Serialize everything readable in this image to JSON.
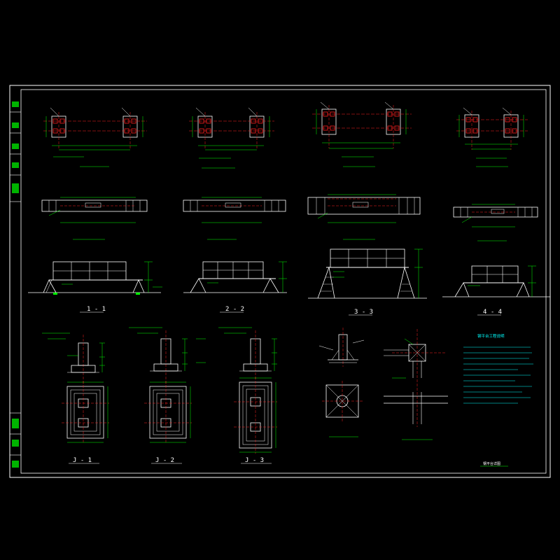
{
  "drawing": {
    "colors": {
      "background": "#000000",
      "frame": "#ffffff",
      "structure": "#ffffff",
      "dimension": "#00ff00",
      "axis": "#ff2020",
      "text": "#ffffff",
      "notes": "#00ffff",
      "accent": "#ffff00"
    },
    "section_labels": [
      "1 - 1",
      "2 - 2",
      "3 - 3",
      "4 - 4"
    ],
    "foundation_labels": [
      "J - 1",
      "J - 2",
      "J - 3"
    ],
    "notes_title": "钢平台工程说明",
    "sheet_label": "钢平台详图"
  }
}
